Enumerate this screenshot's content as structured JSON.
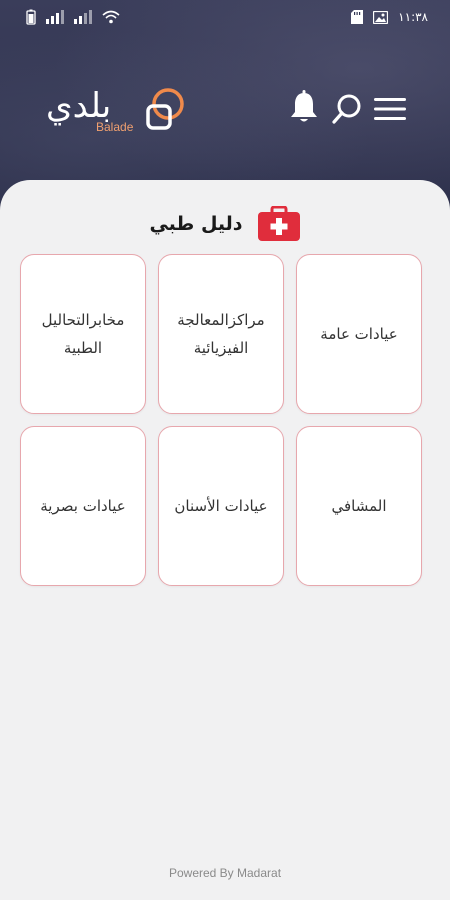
{
  "status_bar": {
    "time": "١١:٣٨"
  },
  "header": {
    "logo_text": "بلدي",
    "logo_subtext": "Balade",
    "icons": [
      "bell-icon",
      "search-icon",
      "menu-icon"
    ]
  },
  "section": {
    "title": "دليل طبي",
    "icon": "first-aid-kit-icon",
    "accent_color": "#e02d3c"
  },
  "categories": [
    {
      "label": "عيادات عامة"
    },
    {
      "label": "مراكزالمعالجة الفيزيائية"
    },
    {
      "label": "مخابرالتحاليل الطبية"
    },
    {
      "label": "المشافي"
    },
    {
      "label": "عيادات الأسنان"
    },
    {
      "label": "عيادات بصرية"
    }
  ],
  "footer": {
    "text": "Powered By Madarat"
  },
  "colors": {
    "header_bg": "#2f3350",
    "card_border": "#e7a7ad",
    "sheet_bg": "#f1f1f2"
  }
}
